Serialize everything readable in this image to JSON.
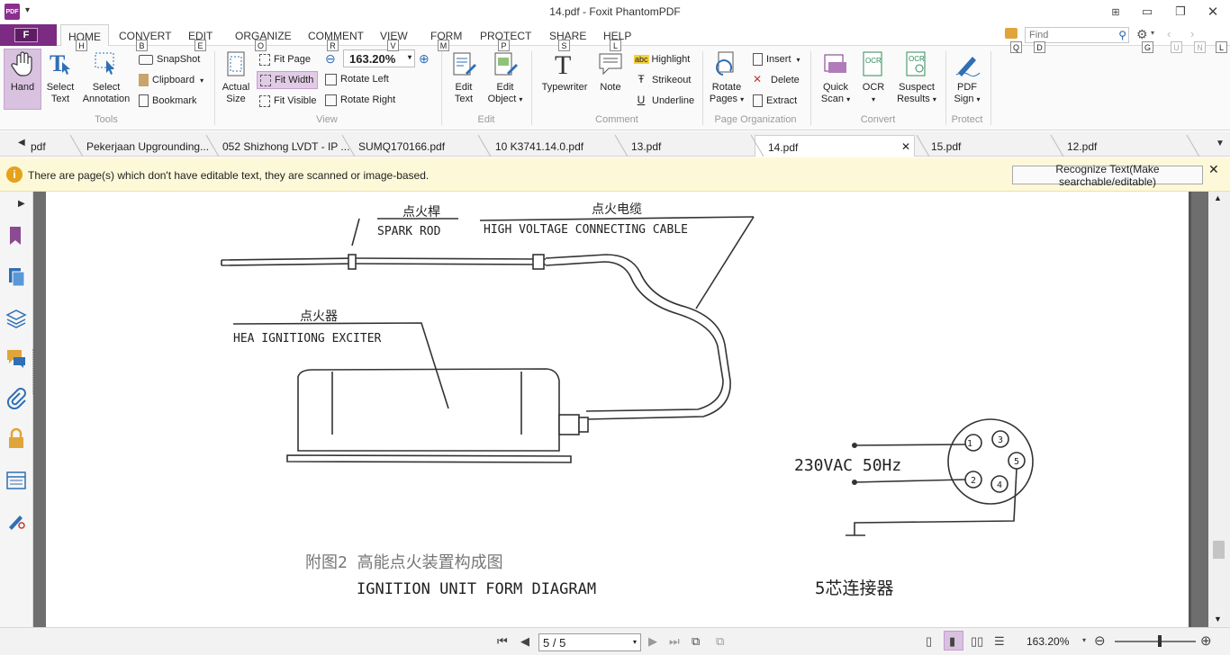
{
  "window": {
    "title": "14.pdf - Foxit PhantomPDF",
    "app_icon_label": "PDF",
    "controls": [
      "minimize",
      "restore",
      "close"
    ]
  },
  "file_tab": {
    "label": "F"
  },
  "ribbon_tabs": [
    {
      "label": "HOME",
      "key": "H",
      "active": true
    },
    {
      "label": "CONVERT",
      "key": "B"
    },
    {
      "label": "EDIT",
      "key": "E"
    },
    {
      "label": "ORGANIZE",
      "key": "O"
    },
    {
      "label": "COMMENT",
      "key": "R"
    },
    {
      "label": "VIEW",
      "key": "V"
    },
    {
      "label": "FORM",
      "key": "M"
    },
    {
      "label": "PROTECT",
      "key": "P"
    },
    {
      "label": "SHARE",
      "key": "S"
    },
    {
      "label": "HELP",
      "key": "L"
    }
  ],
  "right_keys": [
    "Q",
    "D",
    "G",
    "U",
    "N",
    "L"
  ],
  "find": {
    "placeholder": "Find"
  },
  "ribbon": {
    "tools": {
      "label": "Tools",
      "hand": "Hand",
      "select_text_1": "Select",
      "select_text_2": "Text",
      "select_annot_1": "Select",
      "select_annot_2": "Annotation",
      "snapshot": "SnapShot",
      "clipboard": "Clipboard",
      "bookmark": "Bookmark"
    },
    "view": {
      "label": "View",
      "actual_1": "Actual",
      "actual_2": "Size",
      "fit_page": "Fit Page",
      "fit_width": "Fit Width",
      "fit_visible": "Fit Visible",
      "zoom_value": "163.20%",
      "rotate_left": "Rotate Left",
      "rotate_right": "Rotate Right"
    },
    "edit": {
      "label": "Edit",
      "edit_text_1": "Edit",
      "edit_text_2": "Text",
      "edit_object_1": "Edit",
      "edit_object_2": "Object"
    },
    "comment": {
      "label": "Comment",
      "typewriter": "Typewriter",
      "note": "Note",
      "highlight": "Highlight",
      "strikeout": "Strikeout",
      "underline": "Underline",
      "abc": "abc"
    },
    "page_org": {
      "label": "Page Organization",
      "rotate_1": "Rotate",
      "rotate_2": "Pages",
      "insert": "Insert",
      "delete": "Delete",
      "extract": "Extract"
    },
    "convert": {
      "label": "Convert",
      "quick_1": "Quick",
      "quick_2": "Scan",
      "ocr": "OCR",
      "suspect_1": "Suspect",
      "suspect_2": "Results"
    },
    "protect": {
      "label": "Protect",
      "sign_1": "PDF",
      "sign_2": "Sign"
    }
  },
  "doc_tabs": [
    {
      "label": "pdf"
    },
    {
      "label": "Pekerjaan Upgrounding..."
    },
    {
      "label": "052 Shizhong LVDT - IP ..."
    },
    {
      "label": "SUMQ170166.pdf"
    },
    {
      "label": "10 K3741.14.0.pdf"
    },
    {
      "label": "13.pdf"
    },
    {
      "label": "14.pdf",
      "active": true
    },
    {
      "label": "15.pdf"
    },
    {
      "label": "12.pdf"
    }
  ],
  "infobar": {
    "message": "There are page(s) which don't have editable text, they are scanned or image-based.",
    "button": "Recognize Text(Make searchable/editable)"
  },
  "document": {
    "labels": {
      "spark_cn": "点火桿",
      "spark_en": "SPARK ROD",
      "cable_cn": "点火电缆",
      "cable_en": "HIGH VOLTAGE CONNECTING CABLE",
      "exciter_cn": "点火器",
      "exciter_en": "HEA IGNITIONG EXCITER",
      "power": "230VAC 50Hz",
      "caption_cn": "附图2    高能点火装置构成图",
      "caption_en": "IGNITION UNIT FORM DIAGRAM",
      "connector_cn": "5芯连接器"
    },
    "pins": [
      "1",
      "2",
      "3",
      "4",
      "5"
    ]
  },
  "status": {
    "page": "5 / 5",
    "zoom": "163.20%"
  }
}
